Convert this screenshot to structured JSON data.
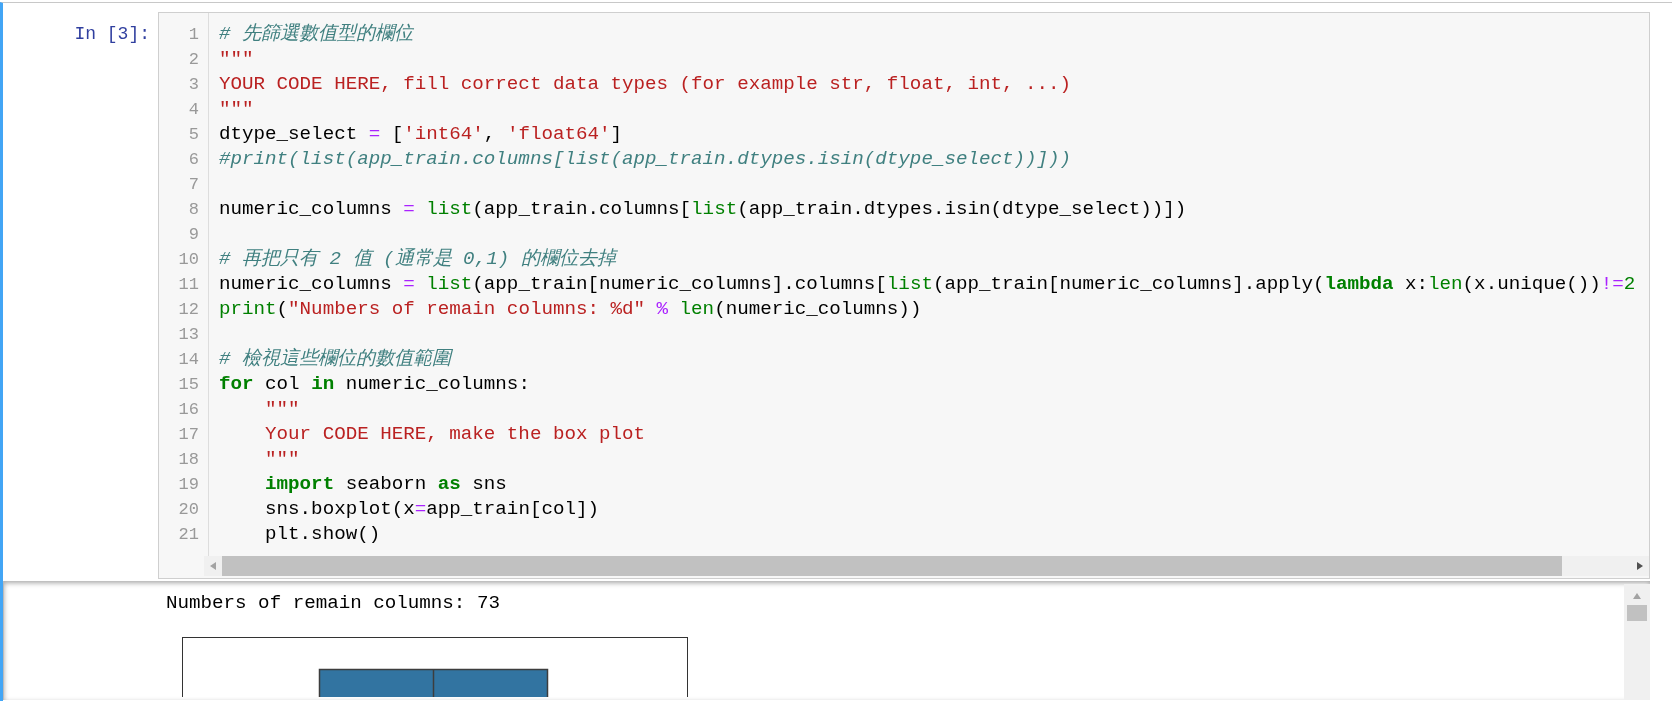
{
  "cell": {
    "prompt": "In [3]:",
    "code_lines": [
      {
        "number": "1",
        "tokens": [
          {
            "kind": "comment",
            "text": "# 先篩選數值型的欄位"
          }
        ]
      },
      {
        "number": "2",
        "tokens": [
          {
            "kind": "string",
            "text": "\"\"\""
          }
        ]
      },
      {
        "number": "3",
        "tokens": [
          {
            "kind": "string",
            "text": "YOUR CODE HERE, fill correct data types (for example str, float, int, ...)"
          }
        ]
      },
      {
        "number": "4",
        "tokens": [
          {
            "kind": "string",
            "text": "\"\"\""
          }
        ]
      },
      {
        "number": "5",
        "tokens": [
          {
            "kind": "plain",
            "text": "dtype_select"
          },
          {
            "kind": "operator",
            "text": " = "
          },
          {
            "kind": "plain",
            "text": "["
          },
          {
            "kind": "string",
            "text": "'int64'"
          },
          {
            "kind": "plain",
            "text": ", "
          },
          {
            "kind": "string",
            "text": "'float64'"
          },
          {
            "kind": "plain",
            "text": "]"
          }
        ]
      },
      {
        "number": "6",
        "tokens": [
          {
            "kind": "comment",
            "text": "#print(list(app_train.columns[list(app_train.dtypes.isin(dtype_select))]))"
          }
        ]
      },
      {
        "number": "7"
      },
      {
        "number": "8",
        "tokens": [
          {
            "kind": "plain",
            "text": "numeric_columns"
          },
          {
            "kind": "operator",
            "text": " = "
          },
          {
            "kind": "builtin",
            "text": "list"
          },
          {
            "kind": "plain",
            "text": "(app_train.columns["
          },
          {
            "kind": "builtin",
            "text": "list"
          },
          {
            "kind": "plain",
            "text": "(app_train.dtypes.isin(dtype_select))])"
          }
        ]
      },
      {
        "number": "9"
      },
      {
        "number": "10",
        "tokens": [
          {
            "kind": "comment",
            "text": "# 再把只有 2 值 (通常是 0,1) 的欄位去掉"
          }
        ]
      },
      {
        "number": "11",
        "tokens": [
          {
            "kind": "plain",
            "text": "numeric_columns"
          },
          {
            "kind": "operator",
            "text": " = "
          },
          {
            "kind": "builtin",
            "text": "list"
          },
          {
            "kind": "plain",
            "text": "(app_train[numeric_columns].columns["
          },
          {
            "kind": "builtin",
            "text": "list"
          },
          {
            "kind": "plain",
            "text": "(app_train[numeric_columns].apply("
          },
          {
            "kind": "keyword",
            "text": "lambda"
          },
          {
            "kind": "plain",
            "text": " x:"
          },
          {
            "kind": "builtin",
            "text": "len"
          },
          {
            "kind": "plain",
            "text": "(x.unique())"
          },
          {
            "kind": "operator",
            "text": "!="
          },
          {
            "kind": "number",
            "text": "2"
          }
        ]
      },
      {
        "number": "12",
        "tokens": [
          {
            "kind": "builtin",
            "text": "print"
          },
          {
            "kind": "plain",
            "text": "("
          },
          {
            "kind": "string",
            "text": "\"Numbers of remain columns: %d\""
          },
          {
            "kind": "operator",
            "text": " % "
          },
          {
            "kind": "builtin",
            "text": "len"
          },
          {
            "kind": "plain",
            "text": "(numeric_columns))"
          }
        ]
      },
      {
        "number": "13"
      },
      {
        "number": "14",
        "tokens": [
          {
            "kind": "comment",
            "text": "# 檢視這些欄位的數值範圍"
          }
        ]
      },
      {
        "number": "15",
        "tokens": [
          {
            "kind": "keyword",
            "text": "for"
          },
          {
            "kind": "plain",
            "text": " col "
          },
          {
            "kind": "keyword",
            "text": "in"
          },
          {
            "kind": "plain",
            "text": " numeric_columns:"
          }
        ]
      },
      {
        "number": "16",
        "tokens": [
          {
            "kind": "string",
            "text": "    \"\"\""
          }
        ]
      },
      {
        "number": "17",
        "tokens": [
          {
            "kind": "string",
            "text": "    Your CODE HERE, make the box plot"
          }
        ]
      },
      {
        "number": "18",
        "tokens": [
          {
            "kind": "string",
            "text": "    \"\"\""
          }
        ]
      },
      {
        "number": "19",
        "tokens": [
          {
            "kind": "keyword",
            "text": "    import"
          },
          {
            "kind": "plain",
            "text": " seaborn "
          },
          {
            "kind": "keyword",
            "text": "as"
          },
          {
            "kind": "plain",
            "text": " sns"
          }
        ]
      },
      {
        "number": "20",
        "tokens": [
          {
            "kind": "plain",
            "text": "    sns.boxplot(x"
          },
          {
            "kind": "operator",
            "text": "="
          },
          {
            "kind": "plain",
            "text": "app_train[col])"
          }
        ]
      },
      {
        "number": "21",
        "tokens": [
          {
            "kind": "plain",
            "text": "    plt.show()"
          }
        ]
      }
    ],
    "output_text": "Numbers of remain columns: 73"
  }
}
